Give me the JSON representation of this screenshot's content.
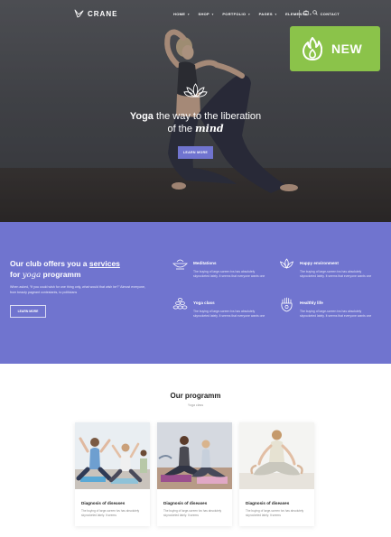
{
  "brand": {
    "logo_text": "CRANE"
  },
  "nav": {
    "items": [
      {
        "label": "HOME",
        "caret": true
      },
      {
        "label": "SHOP",
        "caret": true
      },
      {
        "label": "PORTFOLIO",
        "caret": true
      },
      {
        "label": "PAGES",
        "caret": true
      },
      {
        "label": "ELEMENTS",
        "caret": true
      },
      {
        "label": "CONTACT",
        "caret": false
      }
    ],
    "icons": [
      "cart-icon",
      "search-icon"
    ]
  },
  "badge": {
    "label": "NEW",
    "color": "#8bc34a",
    "icon": "flame-icon"
  },
  "hero": {
    "title_bold": "Yoga",
    "title_rest": " the way to the liberation",
    "title_line2_pre": "of the ",
    "title_line2_italic": "mind",
    "button_label": "LEARN MORE",
    "icon": "lotus-icon"
  },
  "services": {
    "accent": "#7074cf",
    "title_line1_pre": "Our club offers you a ",
    "title_line1_underline": "services",
    "title_line2_pre": "for ",
    "title_line2_italic": "yoga",
    "title_line2_post": " programm",
    "description": "When asked, “If you could wish for one thing only, what would that wish be?” Almost everyone, from beauty pageant contestants, to politicians",
    "button_label": "LEARN MORE",
    "items": [
      {
        "name": "Meditations",
        "text": "The buying of large-screen tvs has absolutely skyrocketed lately. It seems that everyone wants one",
        "icon": "meditation-bowl-icon"
      },
      {
        "name": "Happy environment",
        "text": "The buying of large-screen tvs has absolutely skyrocketed lately. It seems that everyone wants one",
        "icon": "lotus-flower-icon"
      },
      {
        "name": "Yoga class",
        "text": "The buying of large-screen tvs has absolutely skyrocketed lately. It seems that everyone wants one",
        "icon": "stones-pyramid-icon"
      },
      {
        "name": "Healthly life",
        "text": "The buying of large-screen tvs has absolutely skyrocketed lately. It seems that everyone wants one",
        "icon": "hamsa-hand-icon"
      }
    ]
  },
  "programm": {
    "title": "Our programm",
    "subtitle": "Yoga class",
    "cards": [
      {
        "title": "Diagnosis of diseases",
        "text": "The buying of large-screen tvs has absolutely skyrocketed lately. It seems"
      },
      {
        "title": "Diagnosis of diseases",
        "text": "The buying of large-screen tvs has absolutely skyrocketed lately. It seems"
      },
      {
        "title": "Diagnosis of diseases",
        "text": "The buying of large-screen tvs has absolutely skyrocketed lately. It seems"
      }
    ]
  }
}
